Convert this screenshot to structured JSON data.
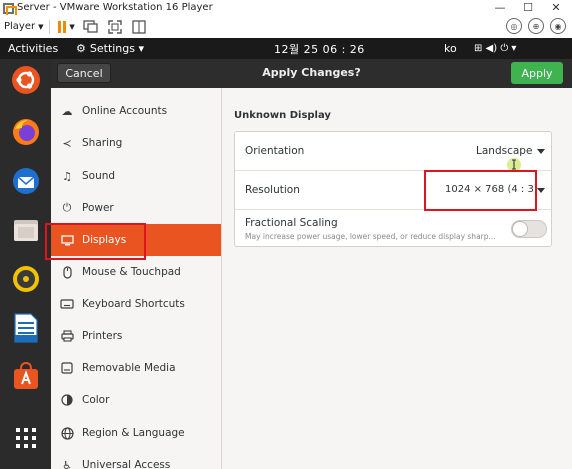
{
  "vmware": {
    "window_title": "Server - VMware Workstation 16 Player",
    "player_menu": "Player",
    "minimize": "—",
    "maximize": "☐",
    "close": "✕"
  },
  "topbar": {
    "activities": "Activities",
    "app_menu": "Settings ▾",
    "clock": "12월 25  06 : 26",
    "input_method": "ko",
    "status_icons": "⊞ ◀) ⏻ ▾"
  },
  "header": {
    "cancel": "Cancel",
    "title": "Apply Changes?",
    "apply": "Apply"
  },
  "sidebar": {
    "items": [
      {
        "label": "Online Accounts",
        "icon": "online-accounts-icon"
      },
      {
        "label": "Sharing",
        "icon": "sharing-icon"
      },
      {
        "label": "Sound",
        "icon": "sound-icon"
      },
      {
        "label": "Power",
        "icon": "power-icon"
      },
      {
        "label": "Displays",
        "icon": "displays-icon",
        "active": true
      },
      {
        "label": "Mouse & Touchpad",
        "icon": "mouse-icon"
      },
      {
        "label": "Keyboard Shortcuts",
        "icon": "keyboard-icon"
      },
      {
        "label": "Printers",
        "icon": "printer-icon"
      },
      {
        "label": "Removable Media",
        "icon": "removable-media-icon"
      },
      {
        "label": "Color",
        "icon": "color-icon"
      },
      {
        "label": "Region & Language",
        "icon": "globe-icon"
      },
      {
        "label": "Universal Access",
        "icon": "accessibility-icon"
      }
    ]
  },
  "display": {
    "name": "Unknown Display",
    "orientation_label": "Orientation",
    "orientation_value": "Landscape",
    "resolution_label": "Resolution",
    "resolution_value": "1024 × 768 (4 : 3)",
    "fractional_label": "Fractional Scaling",
    "fractional_sub": "May increase power usage, lower speed, or reduce display sharp...",
    "fractional_enabled": false
  },
  "colors": {
    "accent": "#e95420",
    "apply_green": "#3eb34f",
    "annotation_red": "#e0141e"
  }
}
